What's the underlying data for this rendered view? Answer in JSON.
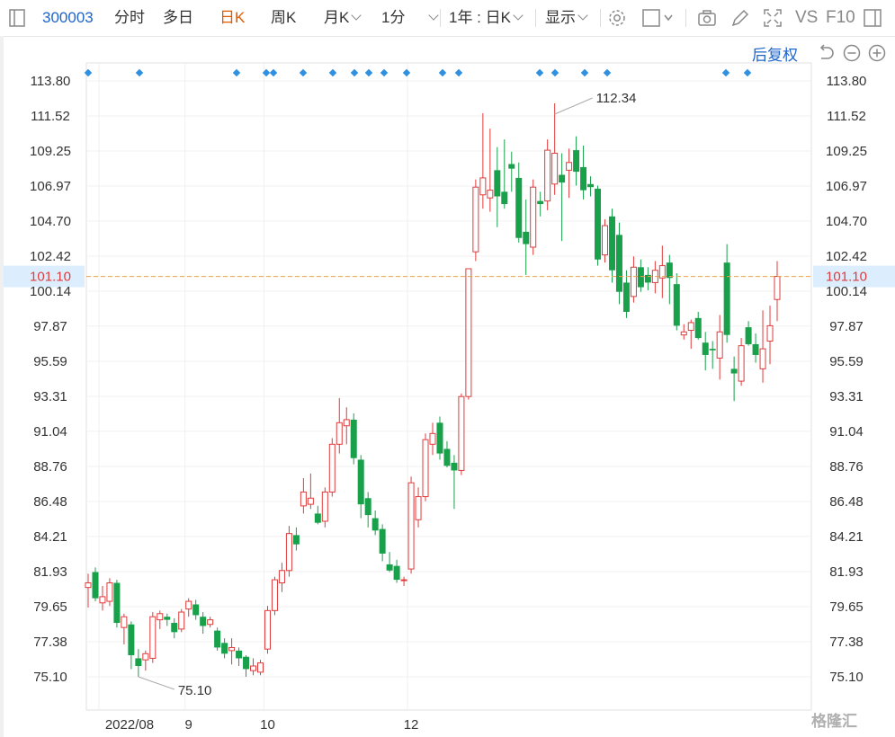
{
  "toolbar": {
    "code": "300003",
    "tabs": [
      "分时",
      "多日",
      "日K",
      "周K"
    ],
    "active_tab": "日K",
    "month_k": "月K",
    "minute": "1分",
    "period": "1年 : 日K",
    "display": "显示",
    "vs": "VS",
    "f10": "F10"
  },
  "subbar": {
    "adjust": "后复权"
  },
  "watermark": "格隆汇",
  "colors": {
    "up": "#e03b3b",
    "down": "#18a04b",
    "marker": "#2f8fe0",
    "current_line": "#e8a050",
    "current_bg": "#dceefe",
    "current_text": "#e03b3b"
  },
  "chart_data": {
    "type": "candlestick",
    "y_ticks": [
      "113.80",
      "111.52",
      "109.25",
      "106.97",
      "104.70",
      "102.42",
      "100.14",
      "97.87",
      "95.59",
      "93.31",
      "91.04",
      "88.76",
      "86.48",
      "84.21",
      "81.93",
      "79.65",
      "77.38",
      "75.10"
    ],
    "ylim": [
      73.96,
      114.94
    ],
    "x_labels": [
      "2022/08",
      "9",
      "10",
      "12"
    ],
    "x_label_index": [
      2,
      14,
      25,
      45
    ],
    "current_price": "101.10",
    "annotations": {
      "high": "112.34",
      "low": "75.10"
    },
    "marker_index": [
      0,
      3,
      10,
      12,
      13,
      15,
      17,
      19,
      20,
      21,
      22,
      24,
      26,
      27,
      31,
      32,
      34,
      36,
      44,
      45
    ],
    "candles": [
      {
        "o": 80.9,
        "h": 81.8,
        "l": 79.6,
        "c": 81.2
      },
      {
        "o": 81.9,
        "h": 82.2,
        "l": 80.0,
        "c": 80.2
      },
      {
        "o": 79.9,
        "h": 81.0,
        "l": 79.4,
        "c": 80.3
      },
      {
        "o": 80.0,
        "h": 81.5,
        "l": 79.7,
        "c": 81.2
      },
      {
        "o": 81.2,
        "h": 81.4,
        "l": 78.3,
        "c": 78.6
      },
      {
        "o": 78.3,
        "h": 79.2,
        "l": 77.2,
        "c": 79.0
      },
      {
        "o": 78.5,
        "h": 78.7,
        "l": 75.6,
        "c": 76.5
      },
      {
        "o": 76.3,
        "h": 76.9,
        "l": 75.1,
        "c": 75.8
      },
      {
        "o": 76.2,
        "h": 76.8,
        "l": 75.5,
        "c": 76.6
      },
      {
        "o": 76.3,
        "h": 79.3,
        "l": 76.0,
        "c": 79.0
      },
      {
        "o": 78.8,
        "h": 79.4,
        "l": 78.2,
        "c": 79.2
      },
      {
        "o": 79.0,
        "h": 79.2,
        "l": 78.4,
        "c": 78.8
      },
      {
        "o": 78.6,
        "h": 78.9,
        "l": 77.6,
        "c": 78.0
      },
      {
        "o": 78.2,
        "h": 79.5,
        "l": 78.0,
        "c": 79.3
      },
      {
        "o": 79.5,
        "h": 80.2,
        "l": 79.0,
        "c": 80.0
      },
      {
        "o": 79.8,
        "h": 80.1,
        "l": 78.8,
        "c": 79.1
      },
      {
        "o": 79.0,
        "h": 79.3,
        "l": 77.9,
        "c": 78.4
      },
      {
        "o": 78.5,
        "h": 79.0,
        "l": 78.3,
        "c": 78.8
      },
      {
        "o": 78.1,
        "h": 78.3,
        "l": 76.8,
        "c": 77.0
      },
      {
        "o": 77.3,
        "h": 77.6,
        "l": 76.3,
        "c": 76.6
      },
      {
        "o": 76.8,
        "h": 77.6,
        "l": 75.9,
        "c": 77.0
      },
      {
        "o": 76.8,
        "h": 77.0,
        "l": 75.8,
        "c": 76.3
      },
      {
        "o": 76.4,
        "h": 76.5,
        "l": 75.1,
        "c": 75.6
      },
      {
        "o": 75.5,
        "h": 76.3,
        "l": 75.2,
        "c": 75.8
      },
      {
        "o": 75.4,
        "h": 76.2,
        "l": 75.2,
        "c": 76.0
      },
      {
        "o": 76.9,
        "h": 79.7,
        "l": 76.6,
        "c": 79.4
      },
      {
        "o": 79.4,
        "h": 81.6,
        "l": 79.1,
        "c": 81.4
      },
      {
        "o": 81.2,
        "h": 82.5,
        "l": 80.6,
        "c": 82.0
      },
      {
        "o": 82.0,
        "h": 84.9,
        "l": 81.6,
        "c": 84.4
      },
      {
        "o": 84.3,
        "h": 84.8,
        "l": 83.3,
        "c": 83.7
      },
      {
        "o": 86.2,
        "h": 88.0,
        "l": 85.7,
        "c": 87.1
      },
      {
        "o": 86.3,
        "h": 88.3,
        "l": 86.0,
        "c": 86.7
      },
      {
        "o": 85.7,
        "h": 86.2,
        "l": 85.0,
        "c": 85.1
      },
      {
        "o": 85.2,
        "h": 87.4,
        "l": 84.8,
        "c": 87.1
      },
      {
        "o": 87.1,
        "h": 90.6,
        "l": 86.8,
        "c": 90.2
      },
      {
        "o": 90.2,
        "h": 93.2,
        "l": 89.6,
        "c": 91.6
      },
      {
        "o": 91.4,
        "h": 92.6,
        "l": 90.2,
        "c": 91.8
      },
      {
        "o": 91.8,
        "h": 92.2,
        "l": 88.9,
        "c": 89.3
      },
      {
        "o": 89.2,
        "h": 89.5,
        "l": 85.4,
        "c": 86.3
      },
      {
        "o": 86.7,
        "h": 87.1,
        "l": 84.8,
        "c": 85.6
      },
      {
        "o": 85.4,
        "h": 85.9,
        "l": 84.3,
        "c": 84.6
      },
      {
        "o": 84.7,
        "h": 85.0,
        "l": 82.6,
        "c": 83.1
      },
      {
        "o": 82.4,
        "h": 83.2,
        "l": 81.9,
        "c": 82.0
      },
      {
        "o": 82.3,
        "h": 82.7,
        "l": 81.2,
        "c": 81.4
      },
      {
        "o": 81.4,
        "h": 81.6,
        "l": 81.0,
        "c": 81.4
      },
      {
        "o": 82.1,
        "h": 88.1,
        "l": 81.8,
        "c": 87.7
      },
      {
        "o": 85.3,
        "h": 87.4,
        "l": 84.8,
        "c": 86.8
      },
      {
        "o": 86.8,
        "h": 90.9,
        "l": 86.5,
        "c": 90.5
      },
      {
        "o": 90.2,
        "h": 91.6,
        "l": 89.5,
        "c": 90.9
      },
      {
        "o": 91.6,
        "h": 92.0,
        "l": 89.2,
        "c": 89.6
      },
      {
        "o": 89.9,
        "h": 90.4,
        "l": 88.7,
        "c": 88.8
      },
      {
        "o": 89.0,
        "h": 89.5,
        "l": 86.0,
        "c": 88.5
      },
      {
        "o": 88.5,
        "h": 93.5,
        "l": 88.2,
        "c": 93.3
      },
      {
        "o": 93.3,
        "h": 101.4,
        "l": 93.1,
        "c": 101.6
      },
      {
        "o": 102.7,
        "h": 107.4,
        "l": 102.1,
        "c": 106.9
      },
      {
        "o": 106.4,
        "h": 111.7,
        "l": 105.5,
        "c": 107.5
      },
      {
        "o": 106.2,
        "h": 110.7,
        "l": 105.3,
        "c": 106.7
      },
      {
        "o": 108.0,
        "h": 109.5,
        "l": 104.3,
        "c": 106.3
      },
      {
        "o": 106.6,
        "h": 110.0,
        "l": 105.5,
        "c": 105.8
      },
      {
        "o": 108.4,
        "h": 109.2,
        "l": 106.6,
        "c": 108.1
      },
      {
        "o": 107.5,
        "h": 108.5,
        "l": 103.3,
        "c": 103.6
      },
      {
        "o": 104.0,
        "h": 106.1,
        "l": 101.2,
        "c": 103.2
      },
      {
        "o": 103.0,
        "h": 107.4,
        "l": 102.5,
        "c": 106.9
      },
      {
        "o": 106.0,
        "h": 106.6,
        "l": 105.0,
        "c": 105.8
      },
      {
        "o": 106.0,
        "h": 110.0,
        "l": 105.4,
        "c": 109.3
      },
      {
        "o": 107.1,
        "h": 112.34,
        "l": 106.4,
        "c": 109.1
      },
      {
        "o": 107.7,
        "h": 109.1,
        "l": 103.4,
        "c": 107.2
      },
      {
        "o": 108.0,
        "h": 109.4,
        "l": 106.2,
        "c": 108.5
      },
      {
        "o": 109.3,
        "h": 110.2,
        "l": 107.0,
        "c": 107.9
      },
      {
        "o": 108.2,
        "h": 109.6,
        "l": 106.1,
        "c": 106.7
      },
      {
        "o": 107.1,
        "h": 107.6,
        "l": 106.3,
        "c": 106.9
      },
      {
        "o": 106.8,
        "h": 107.0,
        "l": 101.8,
        "c": 102.2
      },
      {
        "o": 102.5,
        "h": 104.8,
        "l": 102.0,
        "c": 104.4
      },
      {
        "o": 105.0,
        "h": 105.5,
        "l": 100.7,
        "c": 101.5
      },
      {
        "o": 103.8,
        "h": 104.6,
        "l": 99.3,
        "c": 100.1
      },
      {
        "o": 100.7,
        "h": 101.5,
        "l": 98.4,
        "c": 98.8
      },
      {
        "o": 99.8,
        "h": 102.4,
        "l": 99.4,
        "c": 101.7
      },
      {
        "o": 101.7,
        "h": 102.2,
        "l": 100.1,
        "c": 100.4
      },
      {
        "o": 101.2,
        "h": 101.7,
        "l": 100.2,
        "c": 100.7
      },
      {
        "o": 100.7,
        "h": 102.1,
        "l": 100.0,
        "c": 101.5
      },
      {
        "o": 101.0,
        "h": 103.1,
        "l": 99.7,
        "c": 101.8
      },
      {
        "o": 102.0,
        "h": 102.5,
        "l": 99.3,
        "c": 101.0
      },
      {
        "o": 100.6,
        "h": 101.3,
        "l": 97.6,
        "c": 97.9
      },
      {
        "o": 97.3,
        "h": 98.0,
        "l": 97.0,
        "c": 97.5
      },
      {
        "o": 97.6,
        "h": 98.3,
        "l": 96.4,
        "c": 98.1
      },
      {
        "o": 98.4,
        "h": 98.8,
        "l": 97.0,
        "c": 97.1
      },
      {
        "o": 96.8,
        "h": 97.5,
        "l": 95.0,
        "c": 96.0
      },
      {
        "o": 96.4,
        "h": 96.9,
        "l": 95.1,
        "c": 96.3
      },
      {
        "o": 95.8,
        "h": 98.6,
        "l": 94.4,
        "c": 97.5
      },
      {
        "o": 102.0,
        "h": 103.2,
        "l": 96.8,
        "c": 97.3
      },
      {
        "o": 95.1,
        "h": 95.9,
        "l": 93.0,
        "c": 94.8
      },
      {
        "o": 94.3,
        "h": 97.1,
        "l": 94.0,
        "c": 96.6
      },
      {
        "o": 97.8,
        "h": 98.2,
        "l": 96.6,
        "c": 96.7
      },
      {
        "o": 96.7,
        "h": 97.4,
        "l": 95.5,
        "c": 96.0
      },
      {
        "o": 95.1,
        "h": 98.9,
        "l": 94.2,
        "c": 96.4
      },
      {
        "o": 96.9,
        "h": 99.2,
        "l": 95.4,
        "c": 97.9
      },
      {
        "o": 99.6,
        "h": 102.1,
        "l": 98.2,
        "c": 101.1
      }
    ]
  }
}
